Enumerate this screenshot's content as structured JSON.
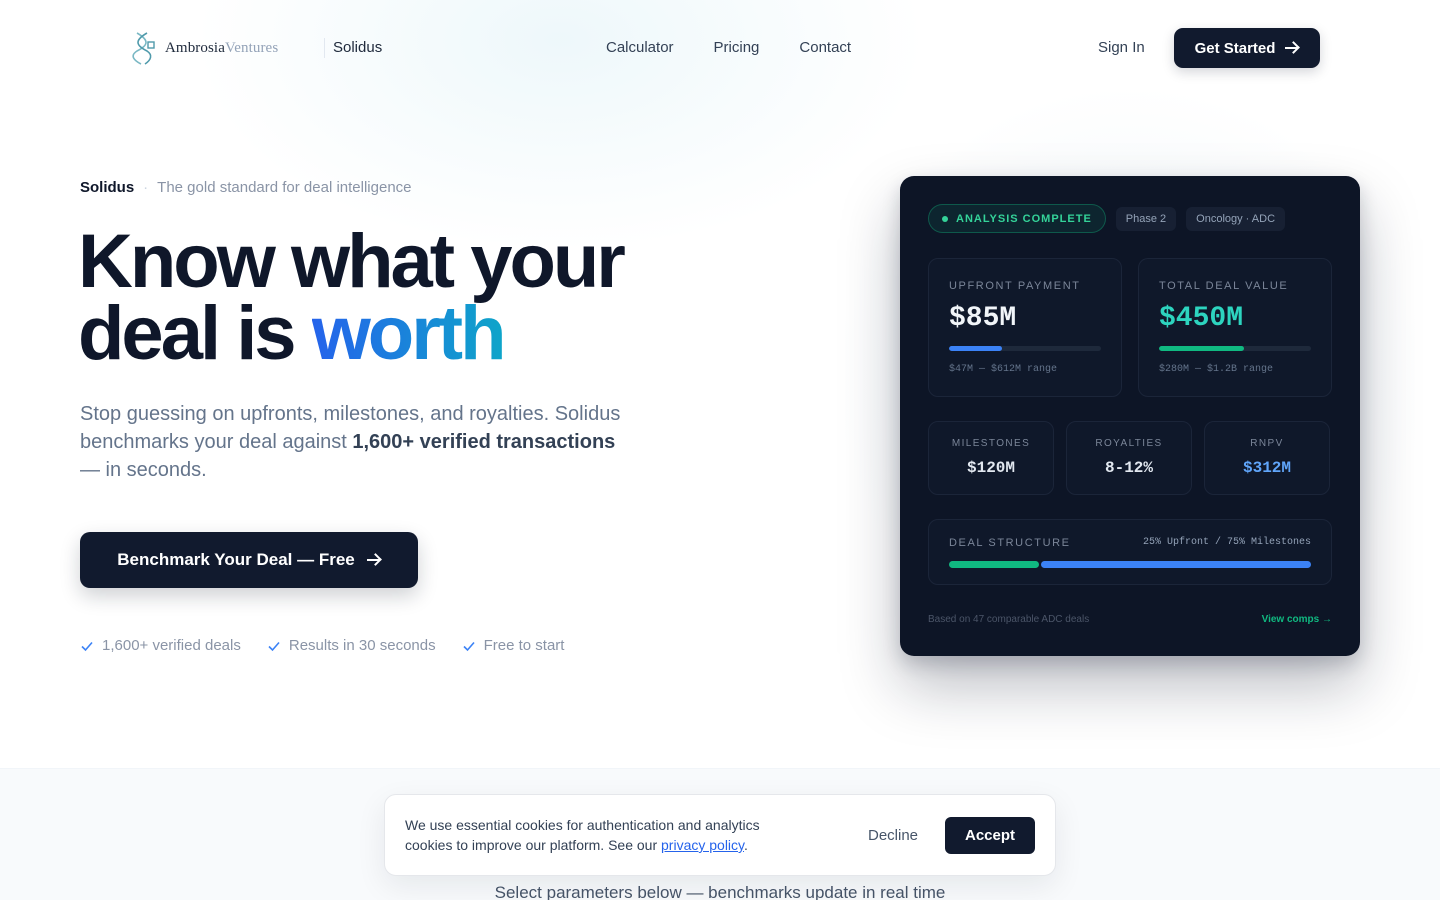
{
  "nav": {
    "logo_primary": "Ambrosia",
    "logo_secondary": "Ventures",
    "product": "Solidus",
    "links": [
      "Calculator",
      "Pricing",
      "Contact"
    ],
    "sign_in": "Sign In",
    "get_started": "Get Started"
  },
  "hero": {
    "eyebrow_brand": "Solidus",
    "eyebrow_separator": "·",
    "eyebrow_tag": "The gold standard for deal intelligence",
    "title_line1": "Know what your",
    "title_line2": "deal is ",
    "title_accent": "worth",
    "sub_part1": "Stop guessing on upfronts, milestones, and royalties. Solidus benchmarks your deal against ",
    "sub_bold": "1,600+ verified transactions",
    "sub_part2": " — in seconds.",
    "cta": "Benchmark Your Deal — Free",
    "checks": [
      "1,600+ verified deals",
      "Results in 30 seconds",
      "Free to start"
    ]
  },
  "card": {
    "status": "ANALYSIS COMPLETE",
    "tags": [
      "Phase 2",
      "Oncology · ADC"
    ],
    "upfront": {
      "label": "UPFRONT PAYMENT",
      "value": "$85M",
      "range": "$47M — $612M range",
      "fill": 0.35
    },
    "total": {
      "label": "TOTAL DEAL VALUE",
      "value": "$450M",
      "range": "$280M — $1.2B range",
      "fill": 0.56
    },
    "milestones": {
      "label": "MILESTONES",
      "value": "$120M"
    },
    "royalties": {
      "label": "ROYALTIES",
      "value": "8-12%"
    },
    "rnpv": {
      "label": "RNPV",
      "value": "$312M"
    },
    "structure": {
      "label": "DEAL STRUCTURE",
      "split": "25% Upfront / 75% Milestones",
      "upfront_pct": 25,
      "milestones_pct": 75
    },
    "footnote": "Based on 47 comparable ADC deals",
    "link": "View comps →"
  },
  "lower": {
    "subtitle": "Select parameters below — benchmarks update in real time"
  },
  "cookie": {
    "text": "We use essential cookies for authentication and analytics cookies to improve our platform. See our ",
    "link": "privacy policy",
    "period": ".",
    "decline": "Decline",
    "accept": "Accept"
  },
  "colors": {
    "primary": "#111a2e",
    "accent_blue": "#2563eb",
    "accent_teal": "#2dd4bf",
    "success_green": "#10b981"
  }
}
